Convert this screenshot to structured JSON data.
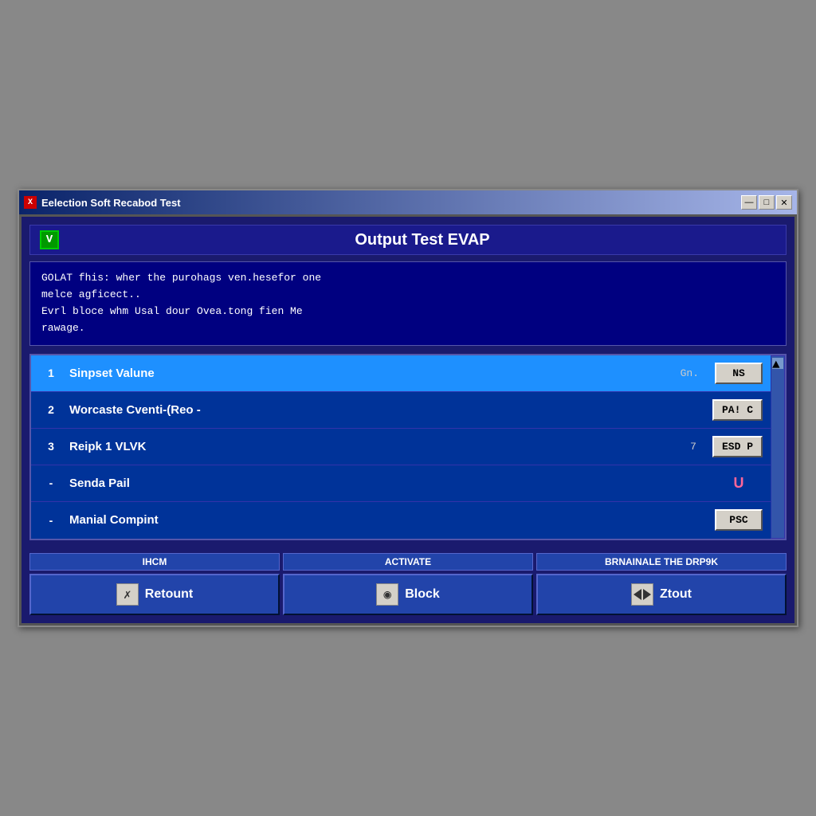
{
  "window": {
    "title": "Eelection Soft Recabod Test",
    "icon_label": "X",
    "btn_minimize": "—",
    "btn_maximize": "□",
    "btn_close": "✕"
  },
  "header": {
    "icon_label": "V",
    "title": "Output Test EVAP"
  },
  "description": {
    "line1": "GOLAT fhis: wher the purohags ven.hesefor one",
    "line2": "melce agficect..",
    "line3": "Evrl bloce whm Usal dour Ovea.tong fien Me",
    "line4": "rawage."
  },
  "table": {
    "rows": [
      {
        "num": "1",
        "label": "Sinpset Valune",
        "sub": "Gn.",
        "value": "NS",
        "value_type": "btn",
        "selected": true
      },
      {
        "num": "2",
        "label": "Worcaste Cventi-(Reo -",
        "sub": "",
        "value": "PA! C",
        "value_type": "btn",
        "selected": false
      },
      {
        "num": "3",
        "label": "Reipk 1 VLVK",
        "sub": "7",
        "value": "ESD P",
        "value_type": "btn",
        "selected": false
      },
      {
        "num": "-",
        "label": "Senda Pail",
        "sub": "",
        "value": "U",
        "value_type": "text",
        "selected": false
      },
      {
        "num": "-",
        "label": "Manial Compint",
        "sub": "",
        "value": "PSC",
        "value_type": "btn",
        "selected": false
      }
    ]
  },
  "bottom": {
    "sections": [
      {
        "label": "IHCM",
        "btn_icon": "✗",
        "btn_text": "Retount"
      },
      {
        "label": "ACTIVATE",
        "btn_icon": "◉",
        "btn_text": "Block"
      },
      {
        "label": "BRNAINALE THE DRP9K",
        "btn_icon": "◀▶",
        "btn_text": "Ztout"
      }
    ]
  }
}
